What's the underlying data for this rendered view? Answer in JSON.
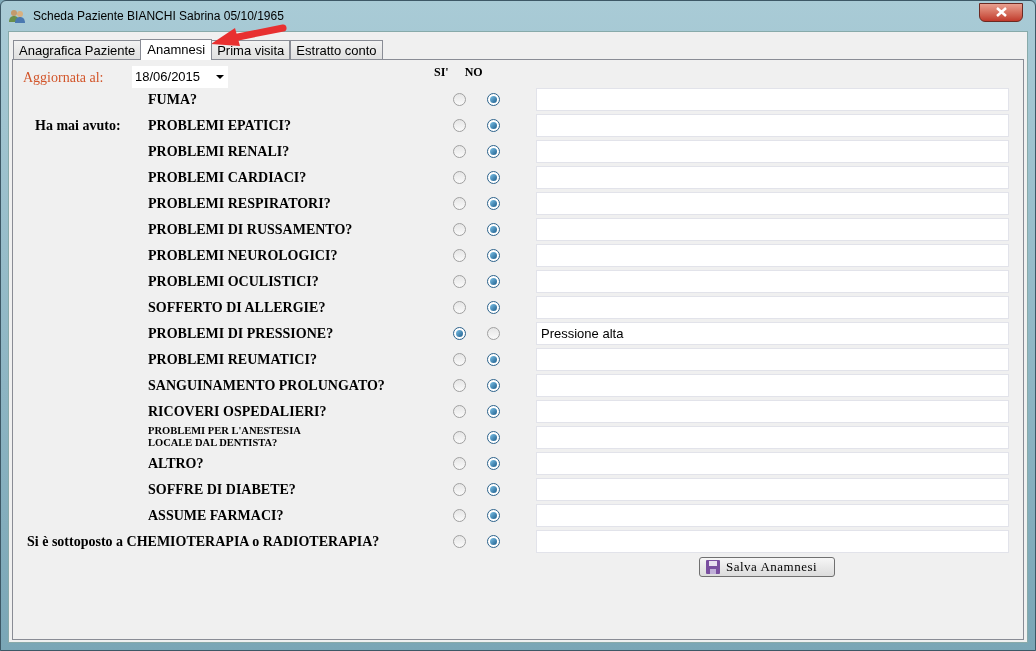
{
  "window": {
    "title": "Scheda Paziente BIANCHI Sabrina 05/10/1965"
  },
  "tabs": [
    {
      "label": "Anagrafica Paziente",
      "selected": false
    },
    {
      "label": "Anamnesi",
      "selected": true
    },
    {
      "label": "Prima visita",
      "selected": false
    },
    {
      "label": "Estratto conto",
      "selected": false
    }
  ],
  "updated": {
    "label": "Aggiornata al:",
    "value": "18/06/2015"
  },
  "columns": {
    "yes": "SI'",
    "no": "NO"
  },
  "rows": [
    {
      "kind": "normal",
      "label": "FUMA?",
      "yes": false,
      "no": true
    },
    {
      "kind": "normal",
      "prefix": "Ha mai avuto:",
      "label": "PROBLEMI EPATICI?",
      "yes": false,
      "no": true
    },
    {
      "kind": "normal",
      "label": "PROBLEMI RENALI?",
      "yes": false,
      "no": true
    },
    {
      "kind": "normal",
      "label": "PROBLEMI CARDIACI?",
      "yes": false,
      "no": true
    },
    {
      "kind": "normal",
      "label": "PROBLEMI RESPIRATORI?",
      "yes": false,
      "no": true
    },
    {
      "kind": "normal",
      "label": "PROBLEMI DI RUSSAMENTO?",
      "yes": false,
      "no": true
    },
    {
      "kind": "normal",
      "label": "PROBLEMI NEUROLOGICI?",
      "yes": false,
      "no": true
    },
    {
      "kind": "normal",
      "label": "PROBLEMI OCULISTICI?",
      "yes": false,
      "no": true
    },
    {
      "kind": "normal",
      "label": "SOFFERTO DI ALLERGIE?",
      "yes": false,
      "no": true
    },
    {
      "kind": "normal",
      "label": "PROBLEMI DI PRESSIONE?",
      "yes": true,
      "no": false,
      "note": "Pressione alta"
    },
    {
      "kind": "normal",
      "label": "PROBLEMI REUMATICI?",
      "yes": false,
      "no": true
    },
    {
      "kind": "normal",
      "label": "SANGUINAMENTO PROLUNGATO?",
      "yes": false,
      "no": true
    },
    {
      "kind": "normal",
      "label": "RICOVERI OSPEDALIERI?",
      "yes": false,
      "no": true
    },
    {
      "kind": "small",
      "label": "PROBLEMI PER L'ANESTESIA\nLOCALE DAL DENTISTA?",
      "yes": false,
      "no": true
    },
    {
      "kind": "normal",
      "label": "ALTRO?",
      "yes": false,
      "no": true
    },
    {
      "kind": "normal",
      "label": "SOFFRE DI DIABETE?",
      "yes": false,
      "no": true
    },
    {
      "kind": "normal",
      "label": "ASSUME FARMACI?",
      "yes": false,
      "no": true
    },
    {
      "kind": "wide",
      "label": "Si è sottoposto a CHEMIOTERAPIA o RADIOTERAPIA?",
      "yes": false,
      "no": true
    }
  ],
  "save_button": {
    "label": "Salva Anamnesi"
  }
}
